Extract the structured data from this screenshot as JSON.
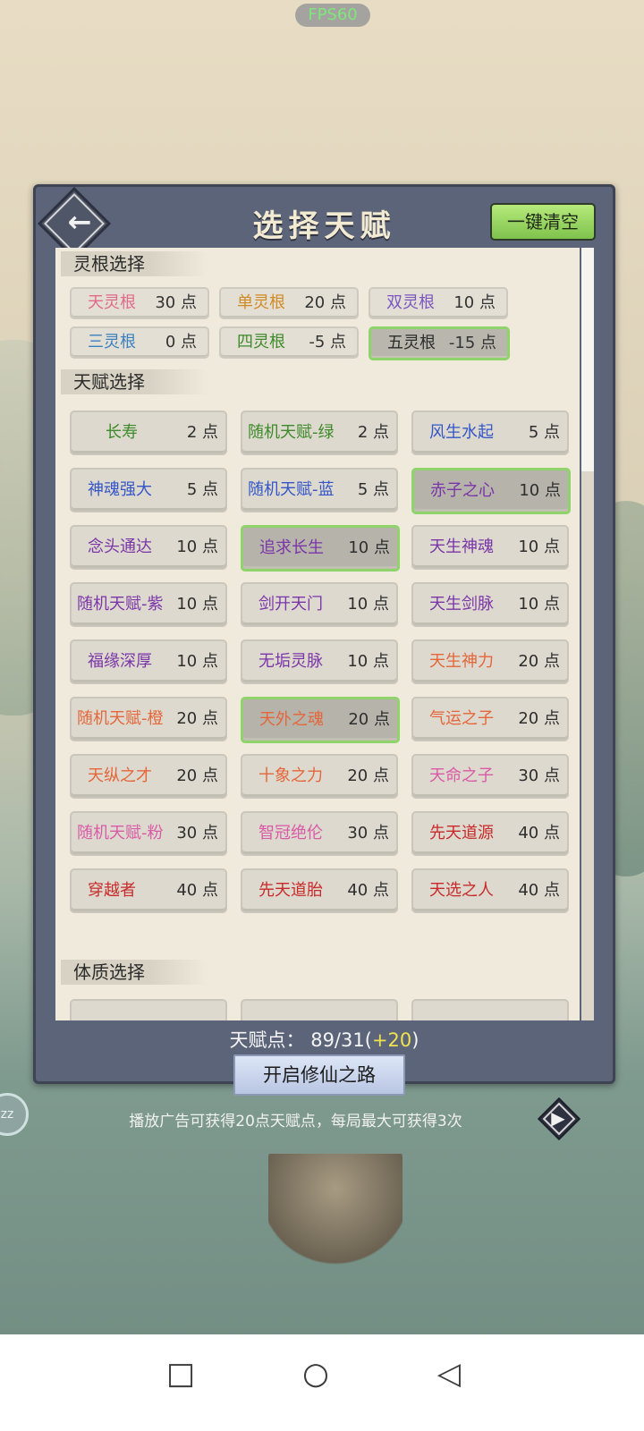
{
  "status": {
    "fps": "FPS60"
  },
  "header": {
    "title": "选择天赋",
    "clear_label": "一键清空",
    "back_icon": "back-arrow-icon"
  },
  "colors": {
    "white": "#ffffff",
    "green": "#3d8a2a",
    "blue": "#3456c8",
    "purple": "#7a35a8",
    "orange": "#e4663a",
    "pink": "#d95aa6",
    "red": "#c82a2a",
    "skyblue": "#3a7fbf",
    "gold": "#d08a24",
    "dark": "#2b2b2b"
  },
  "sections": {
    "root": "灵根选择",
    "talent": "天赋选择",
    "constitution": "体质选择"
  },
  "roots": [
    {
      "name": "天灵根",
      "points": "30 点",
      "color": "#e06a8a",
      "selected": false
    },
    {
      "name": "单灵根",
      "points": "20 点",
      "color": "#d08a24",
      "selected": false
    },
    {
      "name": "双灵根",
      "points": "10 点",
      "color": "#7a55c0",
      "selected": false
    },
    {
      "name": "三灵根",
      "points": "0 点",
      "color": "#3a7fbf",
      "selected": false
    },
    {
      "name": "四灵根",
      "points": "-5 点",
      "color": "#3d8a2a",
      "selected": false
    },
    {
      "name": "五灵根",
      "points": "-15 点",
      "color": "#2b2b2b",
      "selected": true
    }
  ],
  "talents": [
    {
      "name": "长寿",
      "points": "2 点",
      "color": "#3d8a2a",
      "selected": false
    },
    {
      "name": "随机天赋-绿",
      "points": "2 点",
      "color": "#3d8a2a",
      "selected": false
    },
    {
      "name": "风生水起",
      "points": "5 点",
      "color": "#3456c8",
      "selected": false
    },
    {
      "name": "神魂强大",
      "points": "5 点",
      "color": "#3456c8",
      "selected": false
    },
    {
      "name": "随机天赋-蓝",
      "points": "5 点",
      "color": "#3456c8",
      "selected": false
    },
    {
      "name": "赤子之心",
      "points": "10 点",
      "color": "#7a35a8",
      "selected": true
    },
    {
      "name": "念头通达",
      "points": "10 点",
      "color": "#7a35a8",
      "selected": false
    },
    {
      "name": "追求长生",
      "points": "10 点",
      "color": "#7a35a8",
      "selected": true
    },
    {
      "name": "天生神魂",
      "points": "10 点",
      "color": "#7a35a8",
      "selected": false
    },
    {
      "name": "随机天赋-紫",
      "points": "10 点",
      "color": "#7a35a8",
      "selected": false
    },
    {
      "name": "剑开天门",
      "points": "10 点",
      "color": "#7a35a8",
      "selected": false
    },
    {
      "name": "天生剑脉",
      "points": "10 点",
      "color": "#7a35a8",
      "selected": false
    },
    {
      "name": "福缘深厚",
      "points": "10 点",
      "color": "#7a35a8",
      "selected": false
    },
    {
      "name": "无垢灵脉",
      "points": "10 点",
      "color": "#7a35a8",
      "selected": false
    },
    {
      "name": "天生神力",
      "points": "20 点",
      "color": "#e4663a",
      "selected": false
    },
    {
      "name": "随机天赋-橙",
      "points": "20 点",
      "color": "#e4663a",
      "selected": false
    },
    {
      "name": "天外之魂",
      "points": "20 点",
      "color": "#e4663a",
      "selected": true
    },
    {
      "name": "气运之子",
      "points": "20 点",
      "color": "#e4663a",
      "selected": false
    },
    {
      "name": "天纵之才",
      "points": "20 点",
      "color": "#e4663a",
      "selected": false
    },
    {
      "name": "十象之力",
      "points": "20 点",
      "color": "#e4663a",
      "selected": false
    },
    {
      "name": "天命之子",
      "points": "30 点",
      "color": "#d95aa6",
      "selected": false
    },
    {
      "name": "随机天赋-粉",
      "points": "30 点",
      "color": "#d95aa6",
      "selected": false
    },
    {
      "name": "智冠绝伦",
      "points": "30 点",
      "color": "#d95aa6",
      "selected": false
    },
    {
      "name": "先天道源",
      "points": "40 点",
      "color": "#c82a2a",
      "selected": false
    },
    {
      "name": "穿越者",
      "points": "40 点",
      "color": "#c82a2a",
      "selected": false
    },
    {
      "name": "先天道胎",
      "points": "40 点",
      "color": "#c82a2a",
      "selected": false
    },
    {
      "name": "天选之人",
      "points": "40 点",
      "color": "#c82a2a",
      "selected": false
    }
  ],
  "footer": {
    "points_label": "天赋点：",
    "points_value": "89/31",
    "bonus_open": "(",
    "bonus": "+20",
    "bonus_close": ")",
    "start_label": "开启修仙之路",
    "hint": "播放广告可获得20点天赋点，每局最大可获得3次"
  },
  "side": {
    "label": "zz"
  },
  "navbar": {
    "recent_icon": "□",
    "home_icon": "○",
    "back_icon": "◁"
  }
}
